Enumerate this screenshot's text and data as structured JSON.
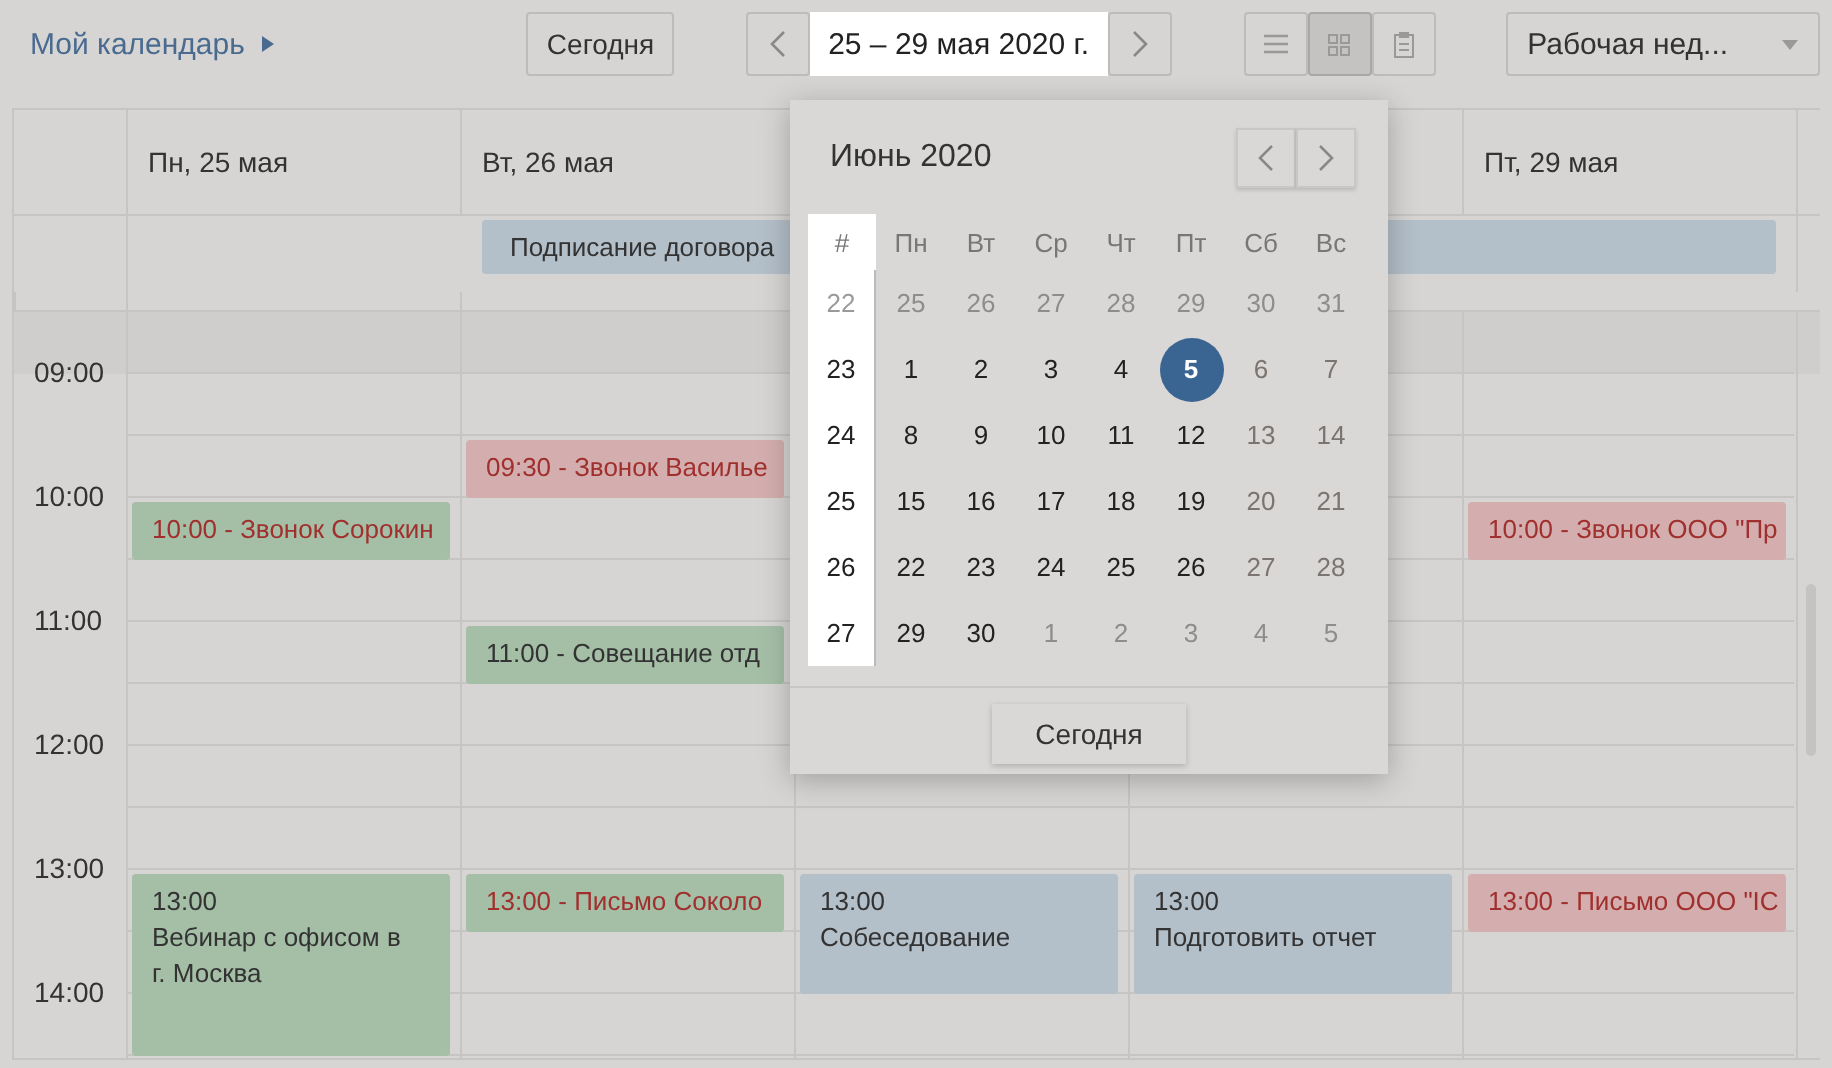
{
  "toolbar": {
    "calendar_link": "Мой календарь",
    "today_button": "Сегодня",
    "date_range": "25 – 29 мая 2020 г.",
    "view_buttons": [
      {
        "kind": "list",
        "selected": false
      },
      {
        "kind": "grid",
        "selected": true
      },
      {
        "kind": "clipboard",
        "selected": false
      }
    ],
    "view_select": "Рабочая нед..."
  },
  "week": {
    "all_day_events": [
      {
        "title": "Подписание договора",
        "color": "#b3bfc9"
      }
    ],
    "time_labels": [
      "09:00",
      "10:00",
      "11:00",
      "12:00",
      "13:00",
      "14:00"
    ],
    "days": [
      {
        "label": "Пн, 25 мая",
        "events": [
          {
            "kind": "short",
            "text": "10:00 - Звонок Сорокин",
            "color": "#a5bfa7",
            "highlighted": true
          },
          {
            "kind": "tall",
            "time": "13:00",
            "title": "Вебинар с офисом в г. Москва",
            "color": "#a5bfa7",
            "highlighted": false
          }
        ]
      },
      {
        "label": "Вт, 26 мая",
        "events": [
          {
            "kind": "short",
            "text": "09:30 - Звонок Василье",
            "color": "#d4aeae",
            "highlighted": true
          },
          {
            "kind": "short",
            "text": "11:00 - Совещание отд",
            "color": "#a5bfa7",
            "highlighted": false
          },
          {
            "kind": "short",
            "text": "13:00 - Письмо Соколо",
            "color": "#a5bfa7",
            "highlighted": true
          }
        ]
      },
      {
        "events": [
          {
            "kind": "block",
            "time": "13:00",
            "title": "Собеседование",
            "color": "#b3bfc9",
            "highlighted": false
          }
        ]
      },
      {
        "events": [
          {
            "kind": "block",
            "time": "13:00",
            "title": "Подготовить отчет",
            "color": "#b3bfc9",
            "highlighted": false
          }
        ]
      },
      {
        "label": "Пт, 29 мая",
        "events": [
          {
            "kind": "short",
            "text": "10:00 - Звонок ООО \"Пр",
            "color": "#d4aeae",
            "highlighted": true
          },
          {
            "kind": "short",
            "text": "13:00 - Письмо ООО \"IC",
            "color": "#d4aeae",
            "highlighted": true
          }
        ]
      }
    ]
  },
  "date_picker": {
    "title": "Июнь 2020",
    "week_header": "#",
    "weekdays": [
      "Пн",
      "Вт",
      "Ср",
      "Чт",
      "Пт",
      "Сб",
      "Вс"
    ],
    "weeks": [
      {
        "number": "22",
        "muted": true,
        "days": [
          {
            "day": "25",
            "muted": true,
            "selected": false
          },
          {
            "day": "26",
            "muted": true,
            "selected": false
          },
          {
            "day": "27",
            "muted": true,
            "selected": false
          },
          {
            "day": "28",
            "muted": true,
            "selected": false
          },
          {
            "day": "29",
            "muted": true,
            "selected": false
          },
          {
            "day": "30",
            "muted": true,
            "selected": false
          },
          {
            "day": "31",
            "muted": true,
            "selected": false
          }
        ]
      },
      {
        "number": "23",
        "muted": false,
        "days": [
          {
            "day": "1",
            "muted": false,
            "selected": false
          },
          {
            "day": "2",
            "muted": false,
            "selected": false
          },
          {
            "day": "3",
            "muted": false,
            "selected": false
          },
          {
            "day": "4",
            "muted": false,
            "selected": false
          },
          {
            "day": "5",
            "muted": false,
            "selected": true
          },
          {
            "day": "6",
            "muted": false,
            "selected": false
          },
          {
            "day": "7",
            "muted": false,
            "selected": false
          }
        ]
      },
      {
        "number": "24",
        "muted": false,
        "days": [
          {
            "day": "8",
            "muted": false,
            "selected": false
          },
          {
            "day": "9",
            "muted": false,
            "selected": false
          },
          {
            "day": "10",
            "muted": false,
            "selected": false
          },
          {
            "day": "11",
            "muted": false,
            "selected": false
          },
          {
            "day": "12",
            "muted": false,
            "selected": false
          },
          {
            "day": "13",
            "muted": false,
            "selected": false
          },
          {
            "day": "14",
            "muted": false,
            "selected": false
          }
        ]
      },
      {
        "number": "25",
        "muted": false,
        "days": [
          {
            "day": "15",
            "muted": false,
            "selected": false
          },
          {
            "day": "16",
            "muted": false,
            "selected": false
          },
          {
            "day": "17",
            "muted": false,
            "selected": false
          },
          {
            "day": "18",
            "muted": false,
            "selected": false
          },
          {
            "day": "19",
            "muted": false,
            "selected": false
          },
          {
            "day": "20",
            "muted": false,
            "selected": false
          },
          {
            "day": "21",
            "muted": false,
            "selected": false
          }
        ]
      },
      {
        "number": "26",
        "muted": false,
        "days": [
          {
            "day": "22",
            "muted": false,
            "selected": false
          },
          {
            "day": "23",
            "muted": false,
            "selected": false
          },
          {
            "day": "24",
            "muted": false,
            "selected": false
          },
          {
            "day": "25",
            "muted": false,
            "selected": false
          },
          {
            "day": "26",
            "muted": false,
            "selected": false
          },
          {
            "day": "27",
            "muted": false,
            "selected": false
          },
          {
            "day": "28",
            "muted": false,
            "selected": false
          }
        ]
      },
      {
        "number": "27",
        "muted": false,
        "days": [
          {
            "day": "29",
            "muted": false,
            "selected": false
          },
          {
            "day": "30",
            "muted": false,
            "selected": false
          },
          {
            "day": "1",
            "muted": true,
            "selected": false
          },
          {
            "day": "2",
            "muted": true,
            "selected": false
          },
          {
            "day": "3",
            "muted": true,
            "selected": false
          },
          {
            "day": "4",
            "muted": true,
            "selected": false
          },
          {
            "day": "5",
            "muted": true,
            "selected": false
          }
        ]
      }
    ],
    "today_button": "Сегодня"
  }
}
